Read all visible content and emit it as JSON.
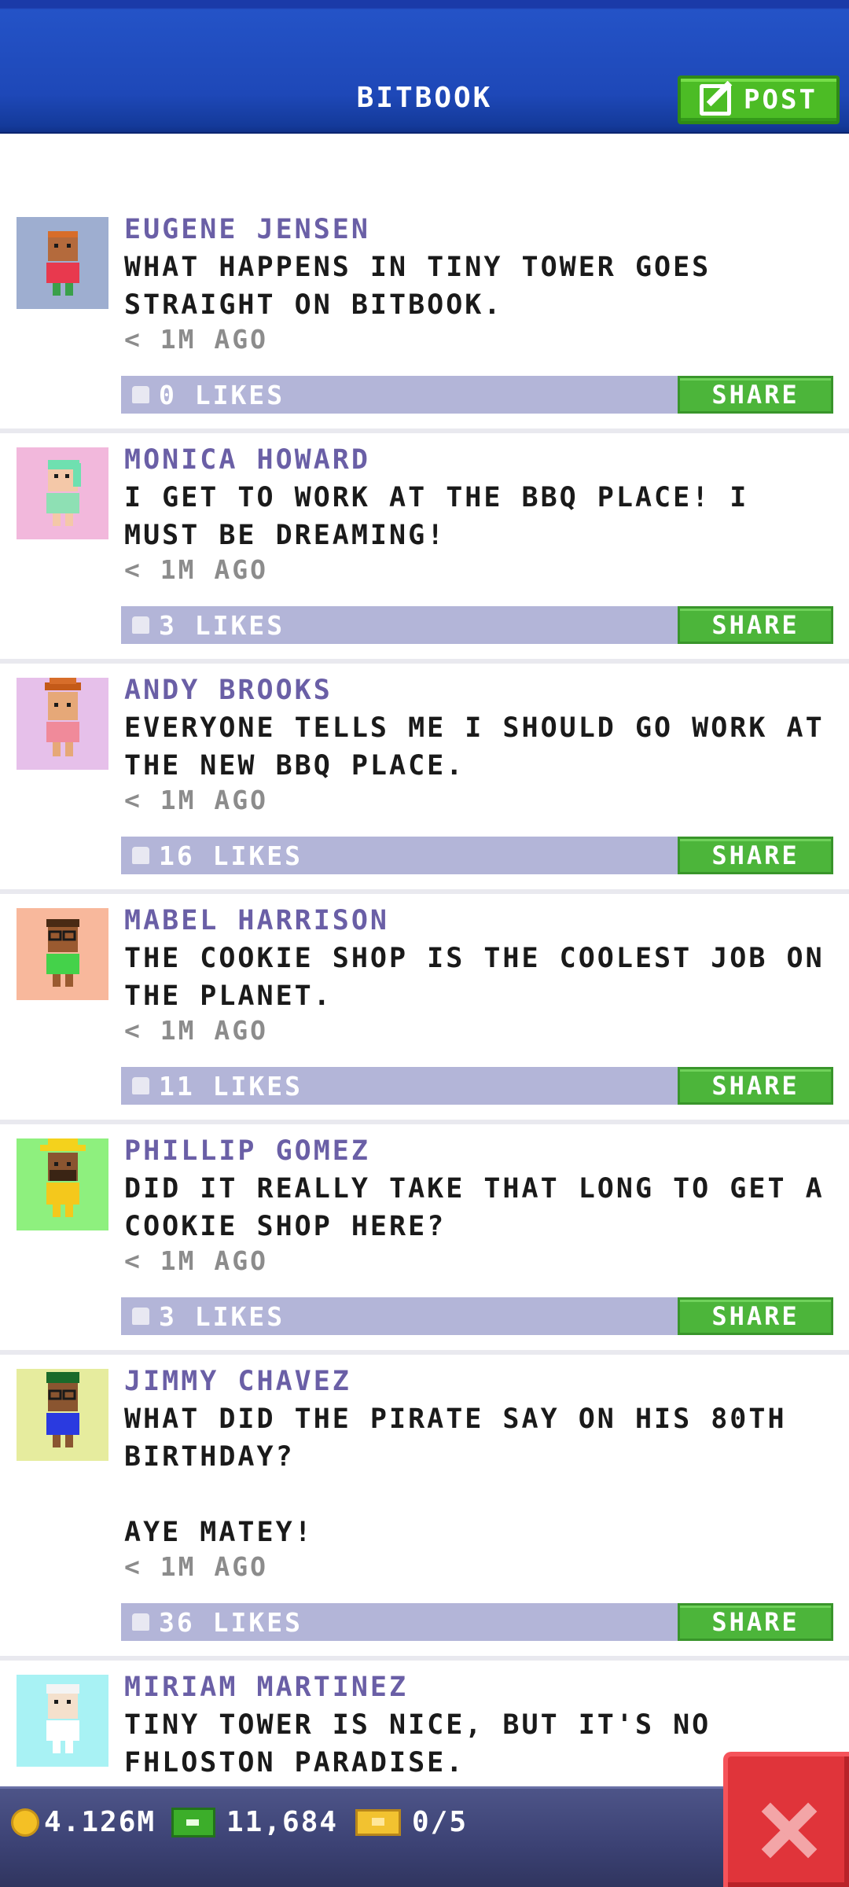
{
  "header": {
    "title": "BITBOOK",
    "post_label": "POST",
    "post_icon": "edit-icon"
  },
  "posts": [
    {
      "name": "EUGENE JENSEN",
      "message": "WHAT HAPPENS IN TINY TOWER GOES STRAIGHT ON BITBOOK.",
      "time": "< 1M AGO",
      "likes": "0 LIKES",
      "share_label": "SHARE",
      "avatar_bg": "#9eaed0"
    },
    {
      "name": "MONICA HOWARD",
      "message": "I GET TO WORK AT THE BBQ PLACE! I MUST BE DREAMING!",
      "time": "< 1M AGO",
      "likes": "3 LIKES",
      "share_label": "SHARE",
      "avatar_bg": "#f2b8dc"
    },
    {
      "name": "ANDY BROOKS",
      "message": "EVERYONE TELLS ME I SHOULD GO WORK AT THE NEW BBQ PLACE.",
      "time": "< 1M AGO",
      "likes": "16 LIKES",
      "share_label": "SHARE",
      "avatar_bg": "#e6c0ea"
    },
    {
      "name": "MABEL HARRISON",
      "message": "THE COOKIE SHOP IS THE COOLEST JOB ON THE PLANET.",
      "time": "< 1M AGO",
      "likes": "11 LIKES",
      "share_label": "SHARE",
      "avatar_bg": "#f8b89c"
    },
    {
      "name": "PHILLIP GOMEZ",
      "message": "DID IT REALLY TAKE THAT LONG TO GET A COOKIE SHOP HERE?",
      "time": "< 1M AGO",
      "likes": "3 LIKES",
      "share_label": "SHARE",
      "avatar_bg": "#8ef07e"
    },
    {
      "name": "JIMMY CHAVEZ",
      "message": "WHAT DID THE PIRATE SAY ON HIS 80TH BIRTHDAY?\n\nAYE MATEY!",
      "time": "< 1M AGO",
      "likes": "36 LIKES",
      "share_label": "SHARE",
      "avatar_bg": "#e6ec9e"
    },
    {
      "name": "MIRIAM MARTINEZ",
      "message": "TINY TOWER IS NICE, BUT IT'S NO FHLOSTON PARADISE.",
      "avatar_bg": "#a8f2f4"
    }
  ],
  "status": {
    "coins": "4.126M",
    "bux": "11,684",
    "tickets": "0/5"
  },
  "close_icon": "close-icon"
}
